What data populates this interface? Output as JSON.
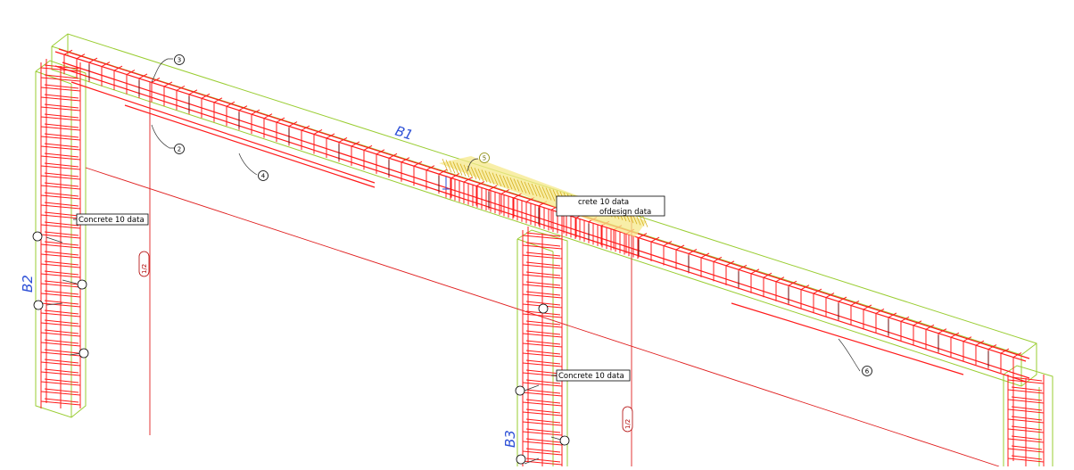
{
  "members": {
    "beam": "B1",
    "column_left": "B2",
    "column_mid": "B3"
  },
  "callouts": {
    "col_left": "Concrete 10 data",
    "col_mid_top": "crete 10 data",
    "design": "ofdesign data",
    "col_mid_low": "Concrete 10 data"
  },
  "bar_marks": {
    "m1": "3",
    "m2": "2",
    "m3": "4",
    "m4": "5",
    "m5": "6"
  },
  "grid_labels": {
    "g1": "1/2",
    "g2": "1/2"
  },
  "colors": {
    "rebar": "#ff1a1a",
    "concrete_outline": "#9acd32",
    "highlight": "#e8d040",
    "label": "#2c4fd6"
  }
}
